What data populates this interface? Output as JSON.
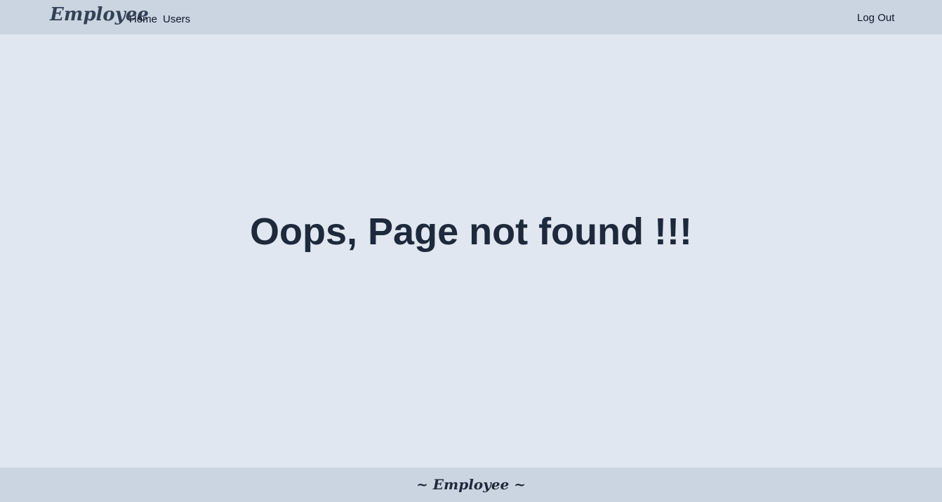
{
  "navbar": {
    "brand": "Employee",
    "links": [
      {
        "label": "Home"
      },
      {
        "label": "Users"
      }
    ],
    "logout_label": "Log Out"
  },
  "main": {
    "heading": "Oops, Page not found !!!"
  },
  "footer": {
    "text": "~ Employee ~"
  },
  "colors": {
    "navbar_bg": "#cbd5e1",
    "page_bg": "#e0e7f0",
    "heading_text": "#1e293b",
    "brand_text": "#334155"
  }
}
